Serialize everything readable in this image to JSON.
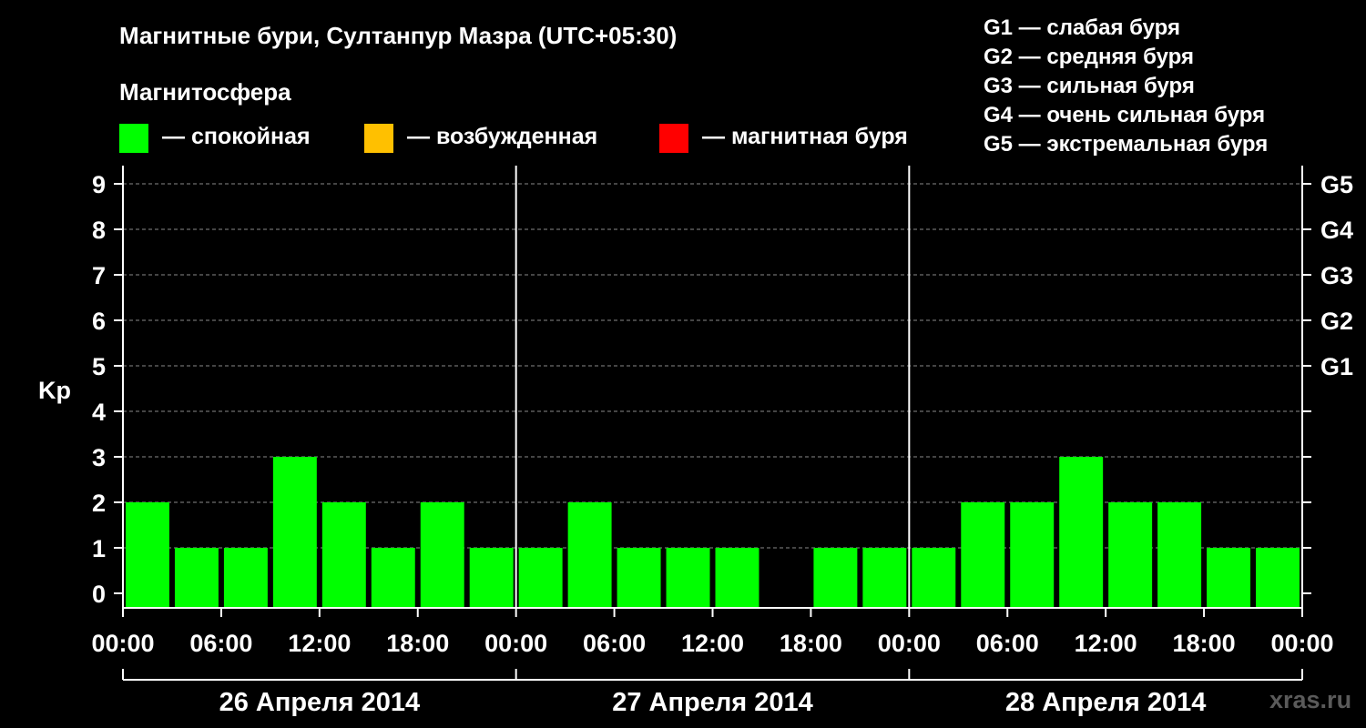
{
  "title": "Магнитные бури, Султанпур Мазра (UTC+05:30)",
  "subtitle": "Магнитосфера",
  "legend": [
    {
      "label": "— спокойная",
      "color": "#00ff00"
    },
    {
      "label": "— возбужденная",
      "color": "#ffc000"
    },
    {
      "label": "— магнитная буря",
      "color": "#ff0000"
    }
  ],
  "g_scale": [
    "G1 — слабая буря",
    "G2 — средняя буря",
    "G3 — сильная буря",
    "G4 — очень сильная буря",
    "G5 — экстремальная буря"
  ],
  "watermark": "xras.ru",
  "chart_data": {
    "type": "bar",
    "ylabel": "Kp",
    "ylim": [
      0,
      9
    ],
    "yticks": [
      0,
      1,
      2,
      3,
      4,
      5,
      6,
      7,
      8,
      9
    ],
    "right_axis": [
      {
        "kp": 5,
        "label": "G1"
      },
      {
        "kp": 6,
        "label": "G2"
      },
      {
        "kp": 7,
        "label": "G3"
      },
      {
        "kp": 8,
        "label": "G4"
      },
      {
        "kp": 9,
        "label": "G5"
      }
    ],
    "x_tick_labels": [
      "00:00",
      "06:00",
      "12:00",
      "18:00",
      "00:00",
      "06:00",
      "12:00",
      "18:00",
      "00:00",
      "06:00",
      "12:00",
      "18:00",
      "00:00"
    ],
    "days": [
      "26 Апреля 2014",
      "27 Апреля 2014",
      "28 Апреля 2014"
    ],
    "interval_hours": 3,
    "values": [
      2,
      1,
      1,
      3,
      2,
      1,
      2,
      1,
      1,
      2,
      1,
      1,
      1,
      0,
      1,
      1,
      1,
      2,
      2,
      3,
      2,
      2,
      1,
      1
    ],
    "grid": "dashed horizontal at each Kp unit",
    "legend_position": "top"
  }
}
